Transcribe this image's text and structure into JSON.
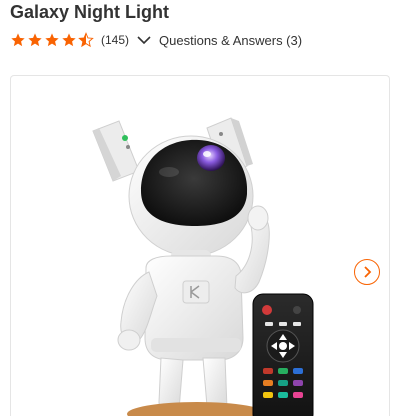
{
  "product": {
    "title": "Galaxy Night Light",
    "rating_value": 4.5,
    "review_count": "(145)",
    "qa_label": "Questions & Answers (3)"
  },
  "colors": {
    "star": "#f96302",
    "accent": "#f96302",
    "text": "#333333"
  },
  "gallery": {
    "next_icon": "chevron-right-icon",
    "image_description_icon": "astronaut-projector-image"
  }
}
